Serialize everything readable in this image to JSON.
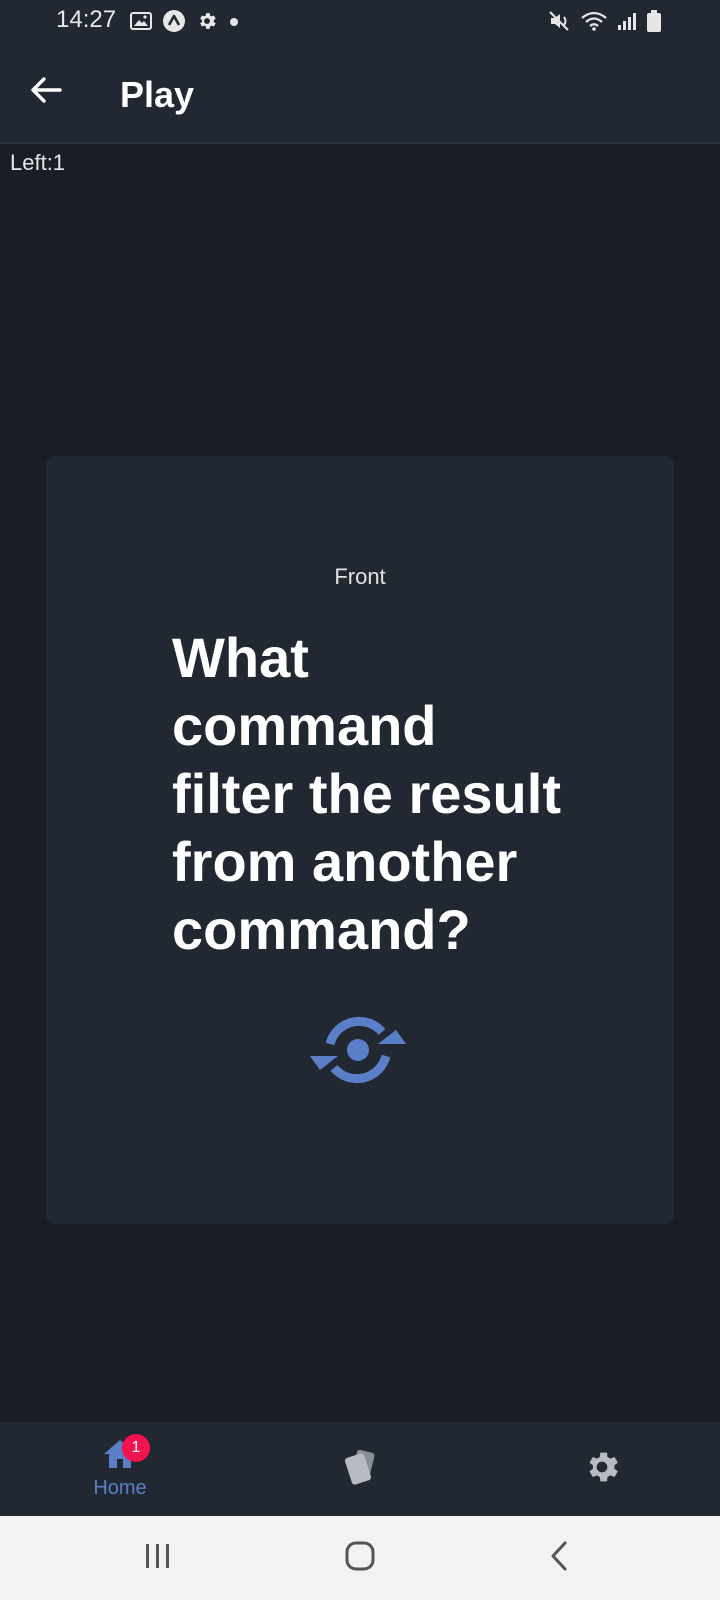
{
  "status_bar": {
    "time": "14:27",
    "left_icons": [
      "image-icon",
      "app-a-icon",
      "settings-gear-icon",
      "dot-icon"
    ],
    "right_icons": [
      "mute-icon",
      "wifi-icon",
      "signal-icon",
      "battery-icon"
    ]
  },
  "app_bar": {
    "title": "Play",
    "back_icon": "arrow-left-icon"
  },
  "counter": {
    "text": "Left:1"
  },
  "card": {
    "side_label": "Front",
    "question": "What command filter the result from another command?",
    "flip_icon": "flip-rotate-icon",
    "accent_color": "#5a7fc8"
  },
  "bottom_nav": {
    "items": [
      {
        "label": "Home",
        "icon": "home-icon",
        "badge": "1",
        "active": true
      },
      {
        "label": "",
        "icon": "cards-icon"
      },
      {
        "label": "",
        "icon": "gear-icon"
      }
    ]
  },
  "system_nav": {
    "buttons": [
      "recents-icon",
      "home-circle-icon",
      "back-chevron-icon"
    ]
  }
}
